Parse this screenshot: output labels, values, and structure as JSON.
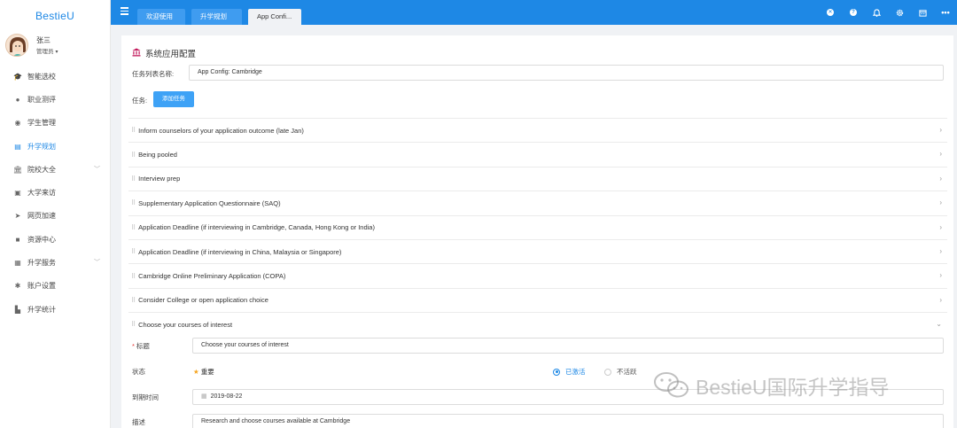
{
  "brand": "BestieU",
  "user": {
    "name": "张三",
    "role": "管理员",
    "caret": "▾"
  },
  "nav": [
    {
      "label": "智能选校",
      "icon": "graduation-cap-icon",
      "glyph": "🎓",
      "active": false,
      "chevron": false
    },
    {
      "label": "职业测评",
      "icon": "user-icon",
      "glyph": "●",
      "active": false,
      "chevron": false
    },
    {
      "label": "学生管理",
      "icon": "users-icon",
      "glyph": "◉",
      "active": false,
      "chevron": false
    },
    {
      "label": "升学规划",
      "icon": "list-icon",
      "glyph": "▤",
      "active": true,
      "chevron": false
    },
    {
      "label": "院校大全",
      "icon": "bank-icon",
      "glyph": "🏛",
      "active": false,
      "chevron": true
    },
    {
      "label": "大学来访",
      "icon": "calendar-icon",
      "glyph": "▣",
      "active": false,
      "chevron": false
    },
    {
      "label": "网页加速",
      "icon": "paper-plane-icon",
      "glyph": "➤",
      "active": false,
      "chevron": false
    },
    {
      "label": "资源中心",
      "icon": "briefcase-icon",
      "glyph": "■",
      "active": false,
      "chevron": false
    },
    {
      "label": "升学服务",
      "icon": "grid-icon",
      "glyph": "▦",
      "active": false,
      "chevron": true
    },
    {
      "label": "账户设置",
      "icon": "gear-icon",
      "glyph": "✱",
      "active": false,
      "chevron": false
    },
    {
      "label": "升学统计",
      "icon": "bar-chart-icon",
      "glyph": "▙",
      "active": false,
      "chevron": false
    }
  ],
  "tabs": [
    {
      "label": "欢迎使用"
    },
    {
      "label": "升学规划"
    },
    {
      "label": "App Confi..."
    }
  ],
  "topbar_icons": [
    "close-circle-icon",
    "help-circle-icon",
    "bell-icon",
    "gear-icon",
    "calendar-icon",
    "more-icon"
  ],
  "page": {
    "title": "系统应用配置",
    "list_name_label": "任务列表名称:",
    "list_name_value": "App Config: Cambridge",
    "tasks_label": "任务:",
    "add_task_label": "添加任务"
  },
  "tasks": [
    "Inform counselors of your application outcome (late Jan)",
    "Being pooled",
    "Interview prep",
    "Supplementary Application Questionnaire (SAQ)",
    "Application Deadline (if interviewing in Cambridge, Canada, Hong Kong or India)",
    "Application Deadline (if interviewing in China, Malaysia or Singapore)",
    "Cambridge Online Preliminary Application (COPA)",
    "Consider College or open application choice",
    "Choose your courses of interest"
  ],
  "detail": {
    "title_label": "标题",
    "title_required": "*",
    "title_value": "Choose your courses of interest",
    "status_label": "状态",
    "important_label": "重要",
    "radio_active": "已激活",
    "radio_inactive": "不活跃",
    "due_label": "到期时间",
    "due_value": "2019-08-22",
    "desc_label": "描述",
    "desc_value": "Research and choose courses available at Cambridge"
  },
  "watermark": "BestieU国际升学指导",
  "colors": {
    "primary": "#1e88e5",
    "accent_button": "#3ea2f6",
    "title_icon": "#c2185b",
    "star": "#f5a623"
  }
}
